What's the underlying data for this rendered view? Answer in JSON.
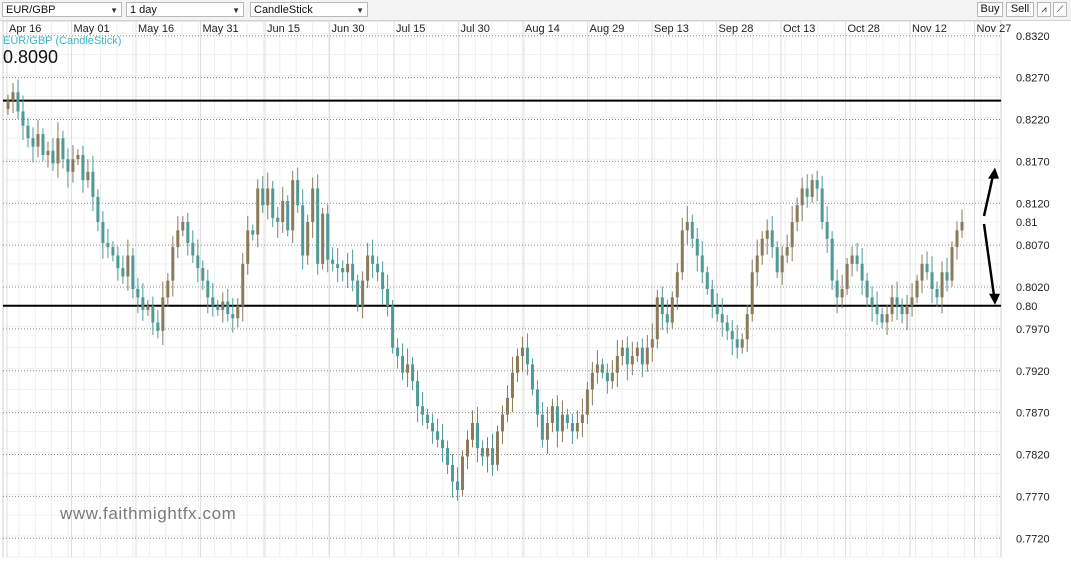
{
  "toolbar": {
    "symbol": "EUR/GBP",
    "period": "1 day",
    "chart_type": "CandleStick",
    "buy_label": "Buy",
    "sell_label": "Sell"
  },
  "watermark": "www.faithmightfx.com",
  "colors": {
    "up": "#8b7a5a",
    "down": "#4f9a98",
    "label": "#3fb6c4"
  },
  "chart_data": {
    "type": "candlestick",
    "title": "EUR/GBP (CandleStick)",
    "last_price": "0.8090",
    "x_tick_labels": [
      "Apr 16",
      "May 01",
      "May 16",
      "May 31",
      "Jun 15",
      "Jun 30",
      "Jul 15",
      "Jul 30",
      "Aug 14",
      "Aug 29",
      "Sep 13",
      "Sep 28",
      "Oct 13",
      "Oct 28",
      "Nov 12",
      "Nov 27"
    ],
    "y_tick_labels": [
      "0.8320",
      "0.8270",
      "0.8220",
      "0.8170",
      "0.8120",
      "0.8070",
      "0.8020",
      "0.7970",
      "0.7920",
      "0.7870",
      "0.7820",
      "0.7770",
      "0.7720"
    ],
    "ylim": [
      0.77,
      0.834
    ],
    "grid": true,
    "horizontal_lines": [
      0.8245,
      0.8
    ],
    "annotations": [
      {
        "text": "0.81",
        "y": 0.81
      },
      {
        "text": "0.80",
        "y": 0.8
      }
    ],
    "closes": [
      0.8245,
      0.8255,
      0.8232,
      0.8215,
      0.82,
      0.819,
      0.8205,
      0.818,
      0.8185,
      0.817,
      0.82,
      0.8175,
      0.816,
      0.8175,
      0.818,
      0.815,
      0.816,
      0.813,
      0.81,
      0.8075,
      0.807,
      0.806,
      0.8045,
      0.8035,
      0.806,
      0.802,
      0.801,
      0.7995,
      0.8,
      0.798,
      0.797,
      0.801,
      0.803,
      0.807,
      0.809,
      0.81,
      0.8075,
      0.806,
      0.8045,
      0.803,
      0.801,
      0.8,
      0.7995,
      0.8005,
      0.799,
      0.7985,
      0.8,
      0.805,
      0.809,
      0.8085,
      0.814,
      0.812,
      0.814,
      0.8105,
      0.81,
      0.8125,
      0.809,
      0.815,
      0.812,
      0.806,
      0.81,
      0.814,
      0.805,
      0.811,
      0.8055,
      0.805,
      0.8045,
      0.804,
      0.805,
      0.803,
      0.8,
      0.803,
      0.806,
      0.805,
      0.804,
      0.802,
      0.8,
      0.795,
      0.794,
      0.792,
      0.793,
      0.791,
      0.788,
      0.787,
      0.786,
      0.785,
      0.784,
      0.783,
      0.781,
      0.779,
      0.778,
      0.782,
      0.784,
      0.786,
      0.783,
      0.782,
      0.783,
      0.781,
      0.785,
      0.787,
      0.789,
      0.792,
      0.794,
      0.795,
      0.793,
      0.79,
      0.787,
      0.784,
      0.786,
      0.788,
      0.785,
      0.787,
      0.786,
      0.785,
      0.786,
      0.787,
      0.79,
      0.792,
      0.793,
      0.792,
      0.791,
      0.792,
      0.794,
      0.795,
      0.793,
      0.794,
      0.795,
      0.793,
      0.795,
      0.796,
      0.801,
      0.799,
      0.798,
      0.801,
      0.804,
      0.809,
      0.81,
      0.808,
      0.806,
      0.804,
      0.802,
      0.8,
      0.799,
      0.798,
      0.797,
      0.796,
      0.795,
      0.796,
      0.799,
      0.804,
      0.806,
      0.808,
      0.809,
      0.807,
      0.804,
      0.806,
      0.807,
      0.81,
      0.812,
      0.814,
      0.813,
      0.815,
      0.814,
      0.81,
      0.808,
      0.803,
      0.801,
      0.802,
      0.805,
      0.806,
      0.805,
      0.803,
      0.801,
      0.8,
      0.799,
      0.798,
      0.799,
      0.801,
      0.8,
      0.799,
      0.8,
      0.801,
      0.803,
      0.805,
      0.804,
      0.802,
      0.801,
      0.804,
      0.803,
      0.807,
      0.809,
      0.81
    ]
  }
}
